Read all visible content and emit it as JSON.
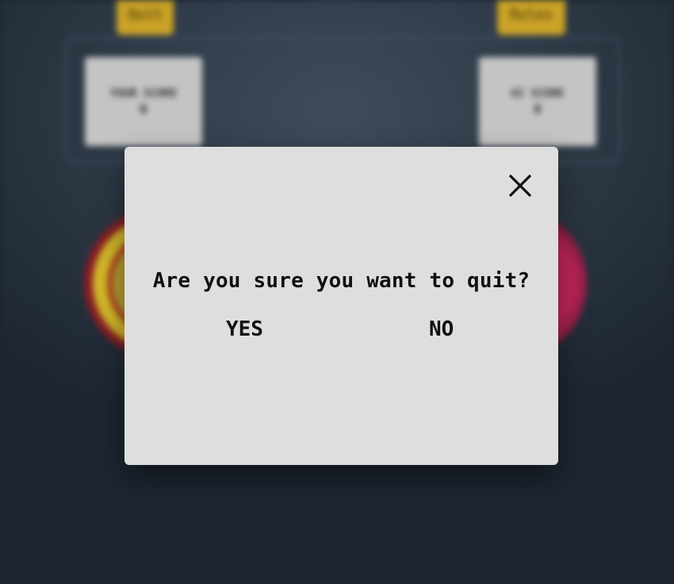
{
  "background": {
    "quit_label": "Quit",
    "rules_label": "Rules",
    "player_score_label": "YOUR SCORE",
    "player_score_value": "0",
    "ai_score_label": "AI SCORE",
    "ai_score_value": "0"
  },
  "dialog": {
    "close_icon": "close-icon",
    "question": "Are you sure you want to quit?",
    "yes_label": "YES",
    "no_label": "NO"
  },
  "colors": {
    "dialog_bg": "#dedede",
    "button_gold": "#c9a227",
    "backdrop": "#2f3b48"
  }
}
